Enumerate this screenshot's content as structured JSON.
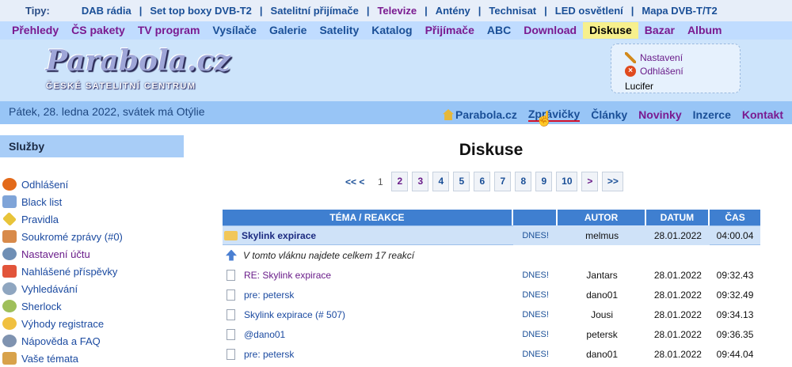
{
  "tips": {
    "label": "Tipy:",
    "items": [
      {
        "label": "DAB rádia"
      },
      {
        "label": "Set top boxy DVB-T2"
      },
      {
        "label": "Satelitní přijímače"
      },
      {
        "label": "Televize"
      },
      {
        "label": "Antény"
      },
      {
        "label": "Technisat"
      },
      {
        "label": "LED osvětlení"
      },
      {
        "label": "Mapa DVB-T/T2"
      }
    ]
  },
  "nav": {
    "items": [
      {
        "label": "Přehledy"
      },
      {
        "label": "ČS pakety"
      },
      {
        "label": "TV program"
      },
      {
        "label": "Vysílače"
      },
      {
        "label": "Galerie"
      },
      {
        "label": "Satelity"
      },
      {
        "label": "Katalog"
      },
      {
        "label": "Přijímače"
      },
      {
        "label": "ABC"
      },
      {
        "label": "Download"
      },
      {
        "label": "Diskuse"
      },
      {
        "label": "Bazar"
      },
      {
        "label": "Album"
      }
    ],
    "active": "Diskuse"
  },
  "header": {
    "logo_text": "Parabola.cz",
    "logo_subtitle": "ČESKÉ SATELITNÍ CENTRUM",
    "user": {
      "settings_label": "Nastavení",
      "logout_label": "Odhlášení",
      "username": "Lucifer"
    }
  },
  "datebar": {
    "date": "Pátek, 28. ledna 2022, svátek má Otýlie",
    "links": [
      {
        "label": "Parabola.cz"
      },
      {
        "label": "Zprávičky"
      },
      {
        "label": "Články"
      },
      {
        "label": "Novinky"
      },
      {
        "label": "Inzerce"
      },
      {
        "label": "Kontakt"
      }
    ]
  },
  "sidebar": {
    "heading": "Služby",
    "items": [
      {
        "label": "Odhlášení",
        "color": "#e36a1a"
      },
      {
        "label": "Black list",
        "color": "#7fa4d8"
      },
      {
        "label": "Pravidla",
        "color": "#e8c43a"
      },
      {
        "label": "Soukromé zprávy (#0)",
        "color": "#d88a4a"
      },
      {
        "label": "Nastavení účtu",
        "color": "#6f8fb5"
      },
      {
        "label": "Nahlášené příspěvky",
        "color": "#e2543a"
      },
      {
        "label": "Vyhledávání",
        "color": "#8fa6c0"
      },
      {
        "label": "Sherlock",
        "color": "#9fbf5a"
      },
      {
        "label": "Výhody registrace",
        "color": "#f0c040"
      },
      {
        "label": "Nápověda a FAQ",
        "color": "#7f93b0"
      },
      {
        "label": "Vaše témata",
        "color": "#d8a24a"
      }
    ]
  },
  "main": {
    "title": "Diskuse",
    "pager": {
      "first": "<< <",
      "current": "1",
      "pages": [
        "2",
        "3",
        "4",
        "5",
        "6",
        "7",
        "8",
        "9",
        "10"
      ],
      "next": ">",
      "last": ">>"
    },
    "table": {
      "headers": [
        "TÉMA / REAKCE",
        "",
        "AUTOR",
        "DATUM",
        "ČAS"
      ],
      "topic": {
        "title": "Skylink expirace",
        "dnes": "DNES!",
        "author": "melmus",
        "date": "28.01.2022",
        "time": "04:00.04"
      },
      "info": "V tomto vláknu najdete celkem 17 reakcí",
      "rows": [
        {
          "title": "RE: Skylink expirace",
          "dnes": "DNES!",
          "author": "Jantars",
          "date": "28.01.2022",
          "time": "09:32.43"
        },
        {
          "title": "pre: petersk",
          "dnes": "DNES!",
          "author": "dano01",
          "date": "28.01.2022",
          "time": "09:32.49"
        },
        {
          "title": "Skylink expirace (# 507)",
          "dnes": "DNES!",
          "author": "Jousi",
          "date": "28.01.2022",
          "time": "09:34.13"
        },
        {
          "title": "@dano01",
          "dnes": "DNES!",
          "author": "petersk",
          "date": "28.01.2022",
          "time": "09:36.35"
        },
        {
          "title": "pre: petersk",
          "dnes": "DNES!",
          "author": "dano01",
          "date": "28.01.2022",
          "time": "09:44.04"
        }
      ]
    }
  }
}
